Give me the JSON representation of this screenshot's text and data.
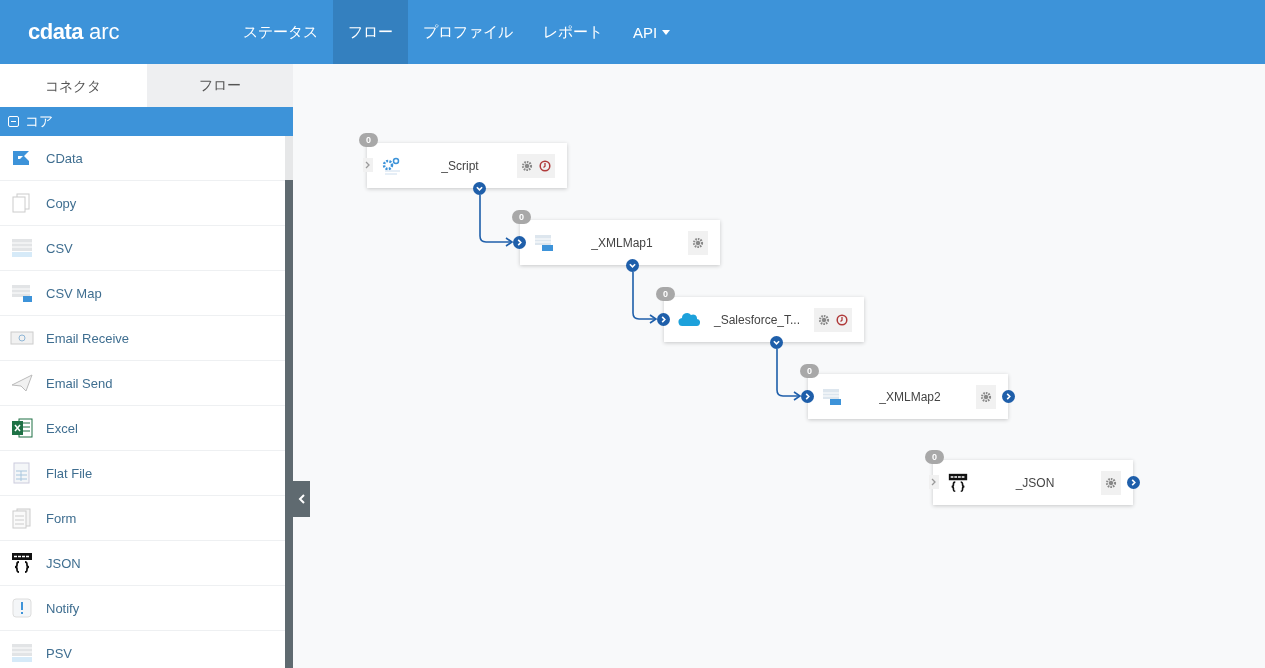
{
  "header": {
    "logo": {
      "brand": "cdata",
      "product": "arc"
    },
    "nav": [
      {
        "label": "ステータス",
        "selected": false,
        "dropdown": false
      },
      {
        "label": "フロー",
        "selected": true,
        "dropdown": false
      },
      {
        "label": "プロファイル",
        "selected": false,
        "dropdown": false
      },
      {
        "label": "レポート",
        "selected": false,
        "dropdown": false
      },
      {
        "label": "API",
        "selected": false,
        "dropdown": true
      }
    ]
  },
  "sidebar": {
    "tabs": [
      {
        "label": "コネクタ",
        "selected": true
      },
      {
        "label": "フロー",
        "selected": false
      }
    ],
    "group": {
      "label": "コア",
      "expanded": true
    },
    "items": [
      {
        "label": "CData",
        "kind": "cdata"
      },
      {
        "label": "Copy",
        "kind": "copy"
      },
      {
        "label": "CSV",
        "kind": "csv"
      },
      {
        "label": "CSV Map",
        "kind": "csvmap"
      },
      {
        "label": "Email Receive",
        "kind": "email-receive"
      },
      {
        "label": "Email Send",
        "kind": "email-send"
      },
      {
        "label": "Excel",
        "kind": "excel"
      },
      {
        "label": "Flat File",
        "kind": "flatfile"
      },
      {
        "label": "Form",
        "kind": "form"
      },
      {
        "label": "JSON",
        "kind": "json"
      },
      {
        "label": "Notify",
        "kind": "notify"
      },
      {
        "label": "PSV",
        "kind": "psv"
      }
    ]
  },
  "flow": {
    "nodes": [
      {
        "label": "_Script",
        "count": "0",
        "kind": "script",
        "input_connected": false,
        "output_below": true,
        "scheduled": true
      },
      {
        "label": "_XMLMap1",
        "count": "0",
        "kind": "xmlmap",
        "input_connected": true,
        "output_below": true,
        "scheduled": false
      },
      {
        "label": "_Salesforce_T...",
        "count": "0",
        "kind": "salesforce",
        "input_connected": true,
        "output_below": true,
        "scheduled": true
      },
      {
        "label": "_XMLMap2",
        "count": "0",
        "kind": "xmlmap",
        "input_connected": true,
        "output_below": false,
        "scheduled": false
      },
      {
        "label": "_JSON",
        "count": "0",
        "kind": "json",
        "input_connected": false,
        "output_below": false,
        "scheduled": false
      }
    ]
  }
}
